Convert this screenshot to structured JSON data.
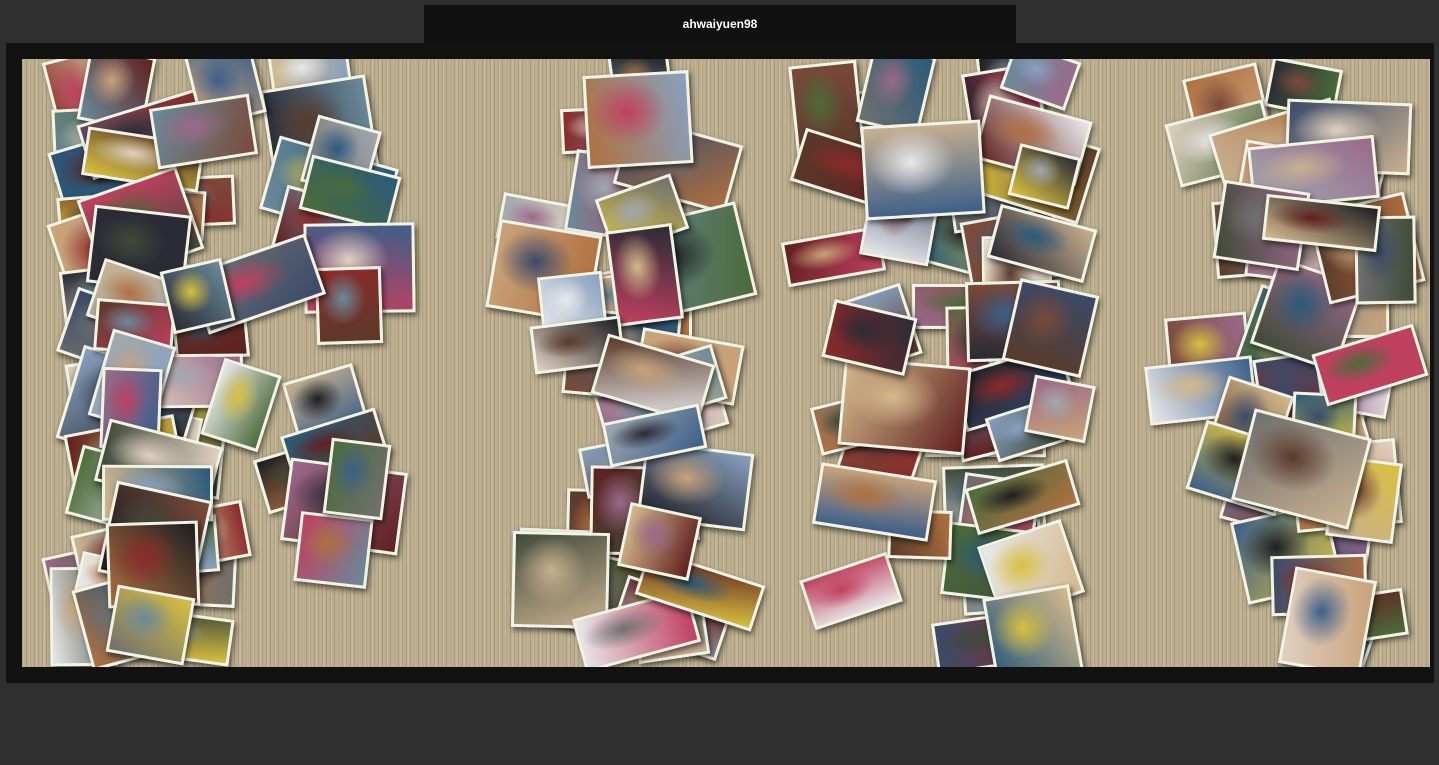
{
  "header": {
    "title": "ahwaiyuen98"
  },
  "collage": {
    "photo_count": 180,
    "palette": [
      "#2b2b35",
      "#7a4a3a",
      "#c9a27a",
      "#3d5f8a",
      "#6a8a9a",
      "#1e1e22",
      "#8c2a2a",
      "#d4b98c",
      "#4b6b3b",
      "#a0a8b0",
      "#5a3a2a",
      "#e0d0c0",
      "#3a4a6a",
      "#c04060",
      "#d8c040",
      "#707070",
      "#2a5a7a",
      "#b07040",
      "#e8e8ea",
      "#404a3a",
      "#9a6a8a",
      "#602020",
      "#88a0c0",
      "#c8b090"
    ]
  }
}
